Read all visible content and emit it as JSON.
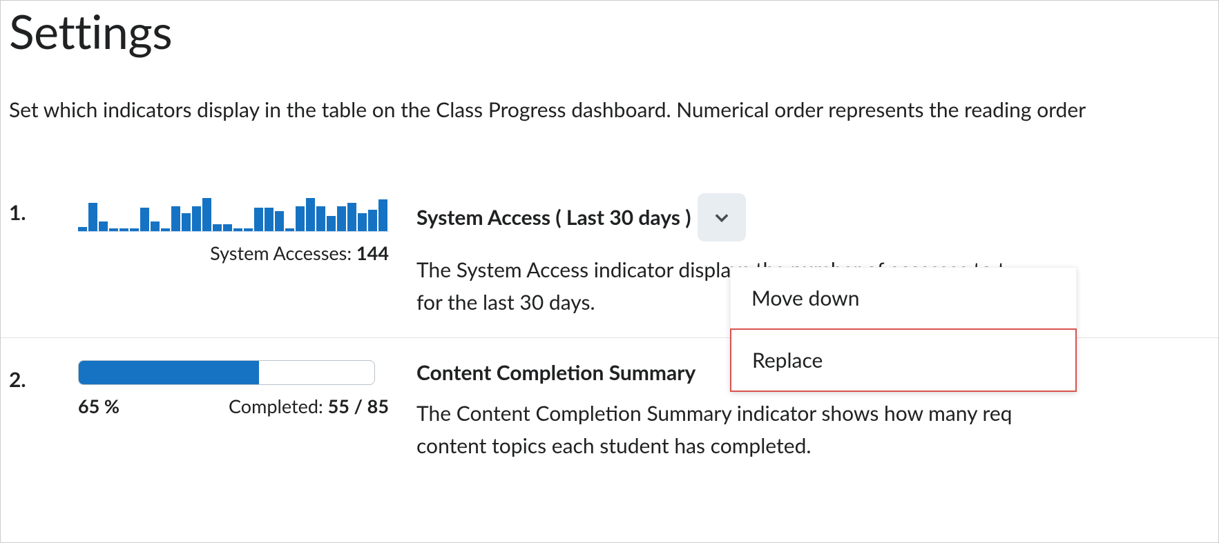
{
  "page": {
    "title": "Settings",
    "description": "Set which indicators display in the table on the Class Progress dashboard. Numerical order represents the reading order"
  },
  "indicators": [
    {
      "ord": "1.",
      "title": "System Access ( Last 30 days )",
      "sparkline_label": "System Accesses: ",
      "sparkline_value": "144",
      "sparkline": [
        5,
        34,
        12,
        3,
        3,
        3,
        28,
        12,
        3,
        30,
        22,
        30,
        40,
        8,
        8,
        3,
        3,
        28,
        28,
        24,
        3,
        30,
        40,
        30,
        18,
        30,
        34,
        22,
        26,
        38
      ],
      "desc_line1": "The System Access indicator displays the number of accesses to t",
      "desc_line2": "for the last 30 days."
    },
    {
      "ord": "2.",
      "title": "Content Completion Summary",
      "percent": "65 %",
      "completed_label": "Completed: ",
      "completed_value": "55 / 85",
      "progress_pct": 61,
      "desc_line1": "The Content Completion Summary indicator shows how many req",
      "desc_line2": "content topics each student has completed."
    }
  ],
  "menu": {
    "move_down": "Move down",
    "replace": "Replace"
  }
}
